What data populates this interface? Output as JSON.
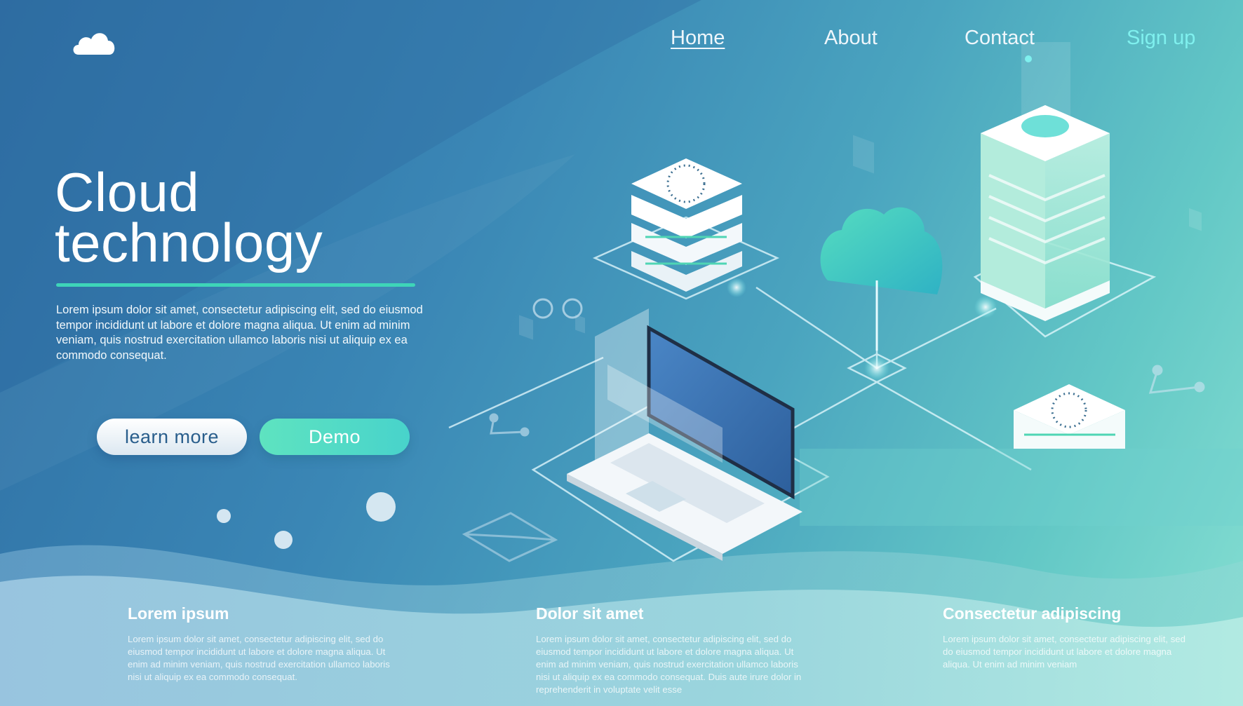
{
  "nav": {
    "items": [
      {
        "label": "Home",
        "active": true
      },
      {
        "label": "About",
        "active": false
      },
      {
        "label": "Contact",
        "active": false
      }
    ],
    "signup_label": "Sign up"
  },
  "hero": {
    "title_line1": "Cloud",
    "title_line2": "technology",
    "description": "Lorem ipsum dolor sit amet, consectetur adipiscing elit, sed do eiusmod tempor incididunt ut labore et dolore magna aliqua. Ut enim ad minim veniam, quis nostrud exercitation ullamco laboris nisi ut aliquip ex ea commodo consequat.",
    "learn_more_label": "learn more",
    "demo_label": "Demo"
  },
  "features": [
    {
      "title": "Lorem ipsum",
      "text": "Lorem ipsum dolor sit amet, consectetur adipiscing elit, sed do eiusmod tempor incididunt ut labore et dolore magna aliqua. Ut enim ad minim veniam, quis nostrud exercitation ullamco laboris nisi ut aliquip ex ea commodo consequat."
    },
    {
      "title": "Dolor sit amet",
      "text": "Lorem ipsum dolor sit amet, consectetur adipiscing elit, sed do eiusmod tempor incididunt ut labore et dolore magna aliqua. Ut enim ad minim veniam, quis nostrud exercitation ullamco laboris nisi ut aliquip ex ea commodo consequat. Duis aute irure dolor in reprehenderit in voluptate velit esse"
    },
    {
      "title": "Consectetur adipiscing",
      "text": "Lorem ipsum dolor sit amet, consectetur adipiscing elit, sed do eiusmod tempor incididunt ut labore et dolore magna aliqua. Ut enim ad minim veniam"
    }
  ],
  "colors": {
    "accent_teal": "#3ed5b8",
    "signup": "#7ff0ee",
    "button_text_blue": "#295e8c"
  },
  "icons": [
    "cloud-logo-icon",
    "gear-icon",
    "network-node-icon",
    "envelope-icon"
  ]
}
